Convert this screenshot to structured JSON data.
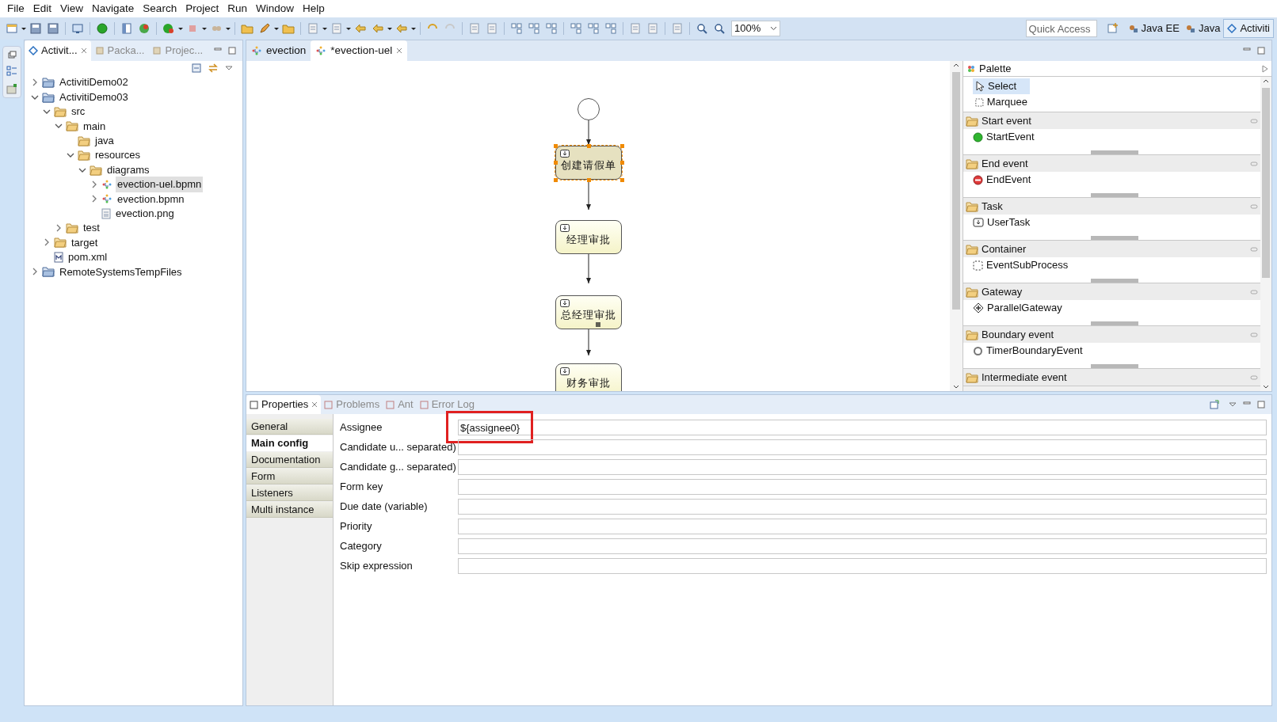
{
  "menu": [
    "File",
    "Edit",
    "View",
    "Navigate",
    "Search",
    "Project",
    "Run",
    "Window",
    "Help"
  ],
  "toolbar": {
    "zoom": "100%",
    "quick_access": {
      "placeholder": "Quick Access"
    },
    "perspectives": [
      {
        "label": "Java EE",
        "selected": false
      },
      {
        "label": "Java",
        "selected": false
      },
      {
        "label": "Activiti",
        "selected": true
      }
    ]
  },
  "explorer": {
    "tabs": [
      {
        "label": "Activit...",
        "selected": true
      },
      {
        "label": "Packa...",
        "selected": false
      },
      {
        "label": "Projec...",
        "selected": false
      }
    ],
    "tree": [
      {
        "label": "ActivitiDemo02",
        "kind": "project",
        "expanded": false,
        "selected": false
      },
      {
        "label": "ActivitiDemo03",
        "kind": "project",
        "expanded": true,
        "selected": false,
        "children": [
          {
            "label": "src",
            "kind": "folder",
            "expanded": true,
            "selected": false,
            "children": [
              {
                "label": "main",
                "kind": "folder",
                "expanded": true,
                "selected": false,
                "children": [
                  {
                    "label": "java",
                    "kind": "folder",
                    "selected": false
                  },
                  {
                    "label": "resources",
                    "kind": "folder",
                    "expanded": true,
                    "selected": false,
                    "children": [
                      {
                        "label": "diagrams",
                        "kind": "folder",
                        "expanded": true,
                        "selected": false,
                        "children": [
                          {
                            "label": "evection-uel.bpmn",
                            "kind": "bpmn",
                            "expanded": false,
                            "selected": true
                          },
                          {
                            "label": "evection.bpmn",
                            "kind": "bpmn",
                            "expanded": false,
                            "selected": false
                          },
                          {
                            "label": "evection.png",
                            "kind": "file",
                            "selected": false
                          }
                        ]
                      }
                    ]
                  }
                ]
              },
              {
                "label": "test",
                "kind": "folder",
                "expanded": false,
                "selected": false
              }
            ]
          },
          {
            "label": "target",
            "kind": "folder",
            "expanded": false,
            "selected": false
          },
          {
            "label": "pom.xml",
            "kind": "xml",
            "selected": false
          }
        ]
      },
      {
        "label": "RemoteSystemsTempFiles",
        "kind": "project",
        "expanded": false,
        "selected": false
      }
    ]
  },
  "editor": {
    "tabs": [
      {
        "label": "evection",
        "selected": false
      },
      {
        "label": "*evection-uel",
        "selected": true
      }
    ],
    "diagram": {
      "nodes": [
        {
          "kind": "start"
        },
        {
          "kind": "task",
          "label": "创建请假单",
          "selected": true,
          "multi": false
        },
        {
          "kind": "task",
          "label": "经理审批",
          "selected": false,
          "multi": false
        },
        {
          "kind": "task",
          "label": "总经理审批",
          "selected": false,
          "multi": true
        },
        {
          "kind": "task",
          "label": "财务审批",
          "selected": false,
          "multi": false
        }
      ]
    }
  },
  "palette": {
    "title": "Palette",
    "tools": [
      {
        "label": "Select",
        "kind": "select",
        "selected": true
      },
      {
        "label": "Marquee",
        "kind": "marquee",
        "selected": false
      }
    ],
    "drawers": [
      {
        "label": "Start event",
        "item": {
          "label": "StartEvent",
          "kind": "start"
        }
      },
      {
        "label": "End event",
        "item": {
          "label": "EndEvent",
          "kind": "end"
        }
      },
      {
        "label": "Task",
        "item": {
          "label": "UserTask",
          "kind": "user"
        }
      },
      {
        "label": "Container",
        "item": {
          "label": "EventSubProcess",
          "kind": "sub"
        }
      },
      {
        "label": "Gateway",
        "item": {
          "label": "ParallelGateway",
          "kind": "gateway"
        }
      },
      {
        "label": "Boundary event",
        "item": {
          "label": "TimerBoundaryEvent",
          "kind": "timer"
        }
      },
      {
        "label": "Intermediate event"
      }
    ]
  },
  "properties": {
    "tabs": [
      {
        "label": "Properties",
        "selected": true
      },
      {
        "label": "Problems",
        "selected": false
      },
      {
        "label": "Ant",
        "selected": false
      },
      {
        "label": "Error Log",
        "selected": false
      }
    ],
    "sections": [
      {
        "label": "General",
        "selected": false
      },
      {
        "label": "Main config",
        "selected": true
      },
      {
        "label": "Documentation",
        "selected": false
      },
      {
        "label": "Form",
        "selected": false
      },
      {
        "label": "Listeners",
        "selected": false
      },
      {
        "label": "Multi instance",
        "selected": false
      }
    ],
    "fields": [
      {
        "label": "Assignee",
        "value": "${assignee0}",
        "highlighted": true
      },
      {
        "label": "Candidate u... separated)",
        "highlighted": false
      },
      {
        "label": "Candidate g... separated)",
        "highlighted": false
      },
      {
        "label": "Form key",
        "highlighted": false
      },
      {
        "label": "Due date (variable)",
        "highlighted": false
      },
      {
        "label": "Priority",
        "highlighted": false
      },
      {
        "label": "Category",
        "highlighted": false
      },
      {
        "label": "Skip expression",
        "highlighted": false
      }
    ]
  }
}
